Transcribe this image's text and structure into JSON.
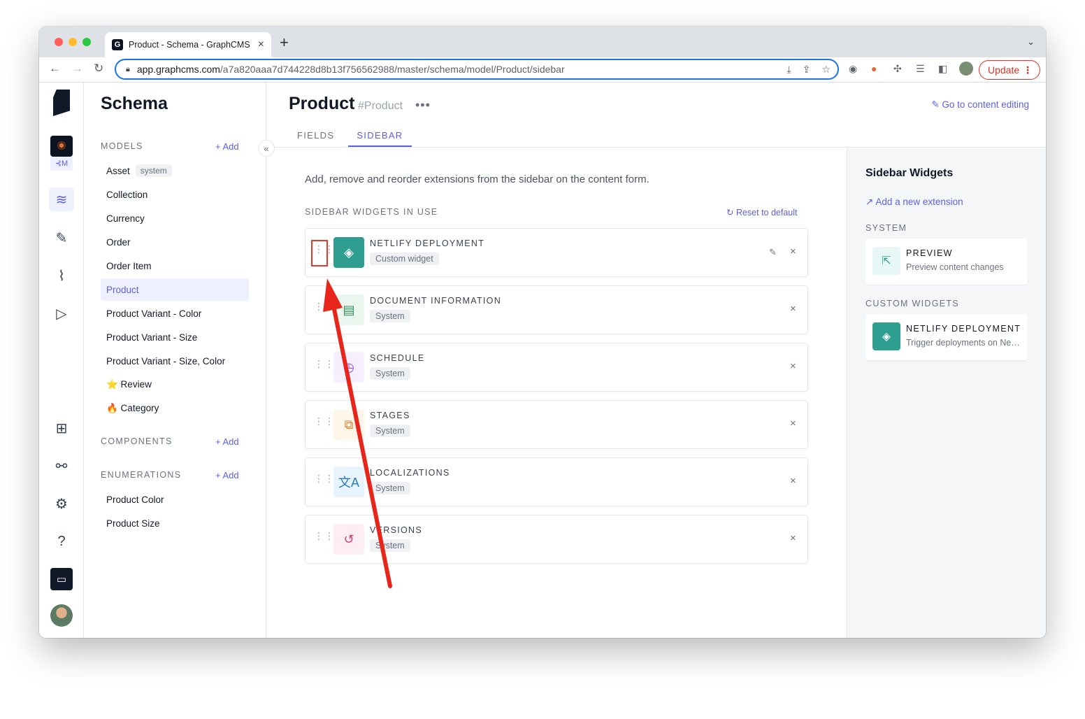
{
  "browser": {
    "tab_title": "Product - Schema - GraphCMS",
    "tab_favicon": "G",
    "url_host": "app.graphcms.com",
    "url_path": "/a7a820aaa7d744228d8b13f756562988/master/schema/model/Product/sidebar",
    "update_label": "Update",
    "colors": {
      "tabstrip": "#dee1e6",
      "accent": "#1a73e8",
      "update": "#d93025"
    }
  },
  "rail": {
    "project_tag": "⊰M"
  },
  "models_panel": {
    "title": "Schema",
    "models_header": "MODELS",
    "add_label": "+ Add",
    "models": [
      {
        "label": "Asset",
        "badge": "system"
      },
      {
        "label": "Collection"
      },
      {
        "label": "Currency"
      },
      {
        "label": "Order"
      },
      {
        "label": "Order Item"
      },
      {
        "label": "Product",
        "active": true
      },
      {
        "label": "Product Variant - Color"
      },
      {
        "label": "Product Variant - Size"
      },
      {
        "label": "Product Variant - Size, Color"
      },
      {
        "label": "⭐ Review"
      },
      {
        "label": "🔥 Category"
      }
    ],
    "components_header": "COMPONENTS",
    "enumerations_header": "ENUMERATIONS",
    "enumerations": [
      {
        "label": "Product Color"
      },
      {
        "label": "Product Size"
      }
    ]
  },
  "main": {
    "title": "Product",
    "api_id": "#Product",
    "go_to_content": "Go to content editing",
    "tabs": [
      {
        "label": "FIELDS"
      },
      {
        "label": "SIDEBAR",
        "active": true
      }
    ],
    "description": "Add, remove and reorder extensions from the sidebar on the content form.",
    "in_use_header": "SIDEBAR WIDGETS IN USE",
    "reset_label": "Reset to default",
    "widgets": [
      {
        "name": "NETLIFY DEPLOYMENT",
        "tag": "Custom widget",
        "icon": "netlify-icon",
        "editable": true
      },
      {
        "name": "DOCUMENT INFORMATION",
        "tag": "System",
        "icon": "document-icon"
      },
      {
        "name": "SCHEDULE",
        "tag": "System",
        "icon": "clock-icon"
      },
      {
        "name": "STAGES",
        "tag": "System",
        "icon": "stages-icon"
      },
      {
        "name": "LOCALIZATIONS",
        "tag": "System",
        "icon": "translate-icon"
      },
      {
        "name": "VERSIONS",
        "tag": "System",
        "icon": "history-icon"
      }
    ],
    "accent": "#5b5fe6"
  },
  "right_panel": {
    "title": "Sidebar Widgets",
    "add_extension": "Add a new extension",
    "system_header": "SYSTEM",
    "system_widgets": [
      {
        "name": "PREVIEW",
        "desc": "Preview content changes",
        "icon": "external-link-icon"
      }
    ],
    "custom_header": "CUSTOM WIDGETS",
    "custom_widgets": [
      {
        "name": "NETLIFY DEPLOYMENT",
        "desc": "Trigger deployments on Netlify",
        "icon": "netlify-icon"
      }
    ]
  },
  "annotation": {
    "color": "#e8251a"
  }
}
